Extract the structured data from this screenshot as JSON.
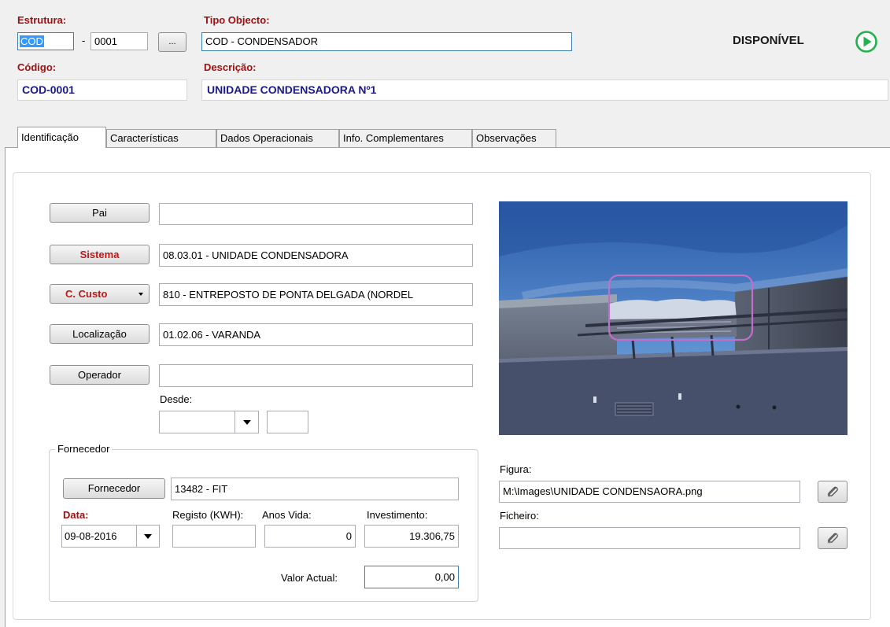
{
  "header": {
    "estrutura_label": "Estrutura:",
    "estrutura_code": "COD",
    "estrutura_sep": "-",
    "estrutura_num": "0001",
    "browse_label": "...",
    "tipo_label": "Tipo Objecto:",
    "tipo_value": "COD - CONDENSADOR",
    "status_text": "DISPONÍVEL",
    "codigo_label": "Código:",
    "codigo_value": "COD-0001",
    "descricao_label": "Descrição:",
    "descricao_value": "UNIDADE CONDENSADORA Nº1"
  },
  "tabs": [
    {
      "label": "Identificação",
      "active": true
    },
    {
      "label": "Características"
    },
    {
      "label": "Dados Operacionais"
    },
    {
      "label": "Info. Complementares"
    },
    {
      "label": "Observações"
    }
  ],
  "form": {
    "pai_button": "Pai",
    "pai_value": "",
    "sistema_button": "Sistema",
    "sistema_value": "08.03.01 - UNIDADE CONDENSADORA",
    "custo_button": "C. Custo",
    "custo_value": "810 - ENTREPOSTO DE PONTA DELGADA (NORDEL",
    "localizacao_button": "Localização",
    "localizacao_value": "01.02.06 - VARANDA",
    "operador_button": "Operador",
    "operador_value": "",
    "desde_label": "Desde:",
    "desde_date": "",
    "desde_time": ""
  },
  "fornecedor": {
    "group_title": "Fornecedor",
    "button": "Fornecedor",
    "value": "13482 - FIT",
    "data_label": "Data:",
    "data_value": "09-08-2016",
    "registo_label": "Registo (KWH):",
    "registo_value": "",
    "anos_label": "Anos Vida:",
    "anos_value": "0",
    "investimento_label": "Investimento:",
    "investimento_value": "19.306,75",
    "valor_label": "Valor Actual:",
    "valor_value": "0,00"
  },
  "media": {
    "figura_label": "Figura:",
    "figura_value": "M:\\Images\\UNIDADE CONDENSAORA.png",
    "ficheiro_label": "Ficheiro:",
    "ficheiro_value": ""
  },
  "colors": {
    "status_green": "#22b14c",
    "label_red": "#a01010",
    "title_blue": "#1a1a8c"
  }
}
